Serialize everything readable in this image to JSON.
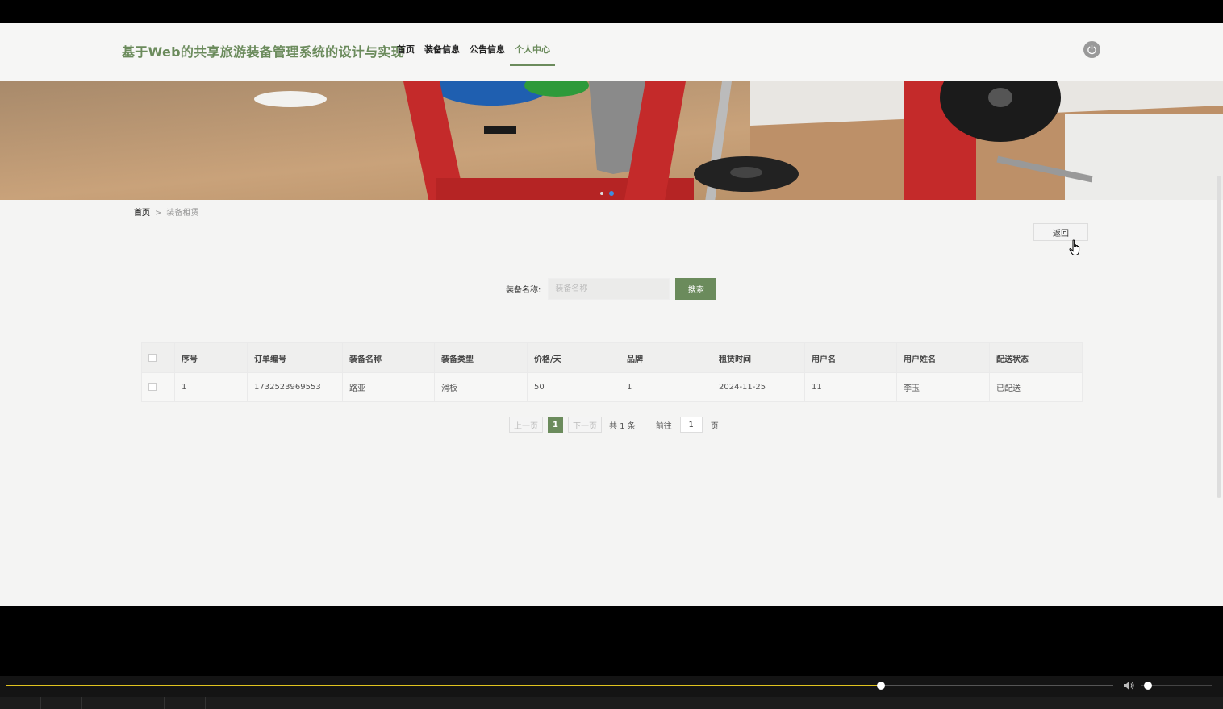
{
  "header": {
    "site_title": "基于Web的共享旅游装备管理系统的设计与实现",
    "nav": [
      "首页",
      "装备信息",
      "公告信息",
      "个人中心"
    ],
    "active_nav": "个人中心"
  },
  "breadcrumb": {
    "home": "首页",
    "separator": ">",
    "current": "装备租赁"
  },
  "actions": {
    "back_label": "返回"
  },
  "search": {
    "label": "装备名称:",
    "placeholder": "装备名称",
    "value": "",
    "button_label": "搜索"
  },
  "table": {
    "columns": [
      "序号",
      "订单编号",
      "装备名称",
      "装备类型",
      "价格/天",
      "品牌",
      "租赁时间",
      "用户名",
      "用户姓名",
      "配送状态"
    ],
    "rows": [
      [
        "1",
        "1732523969553",
        "路亚",
        "滑板",
        "50",
        "1",
        "2024-11-25",
        "11",
        "李玉",
        "已配送"
      ]
    ]
  },
  "pagination": {
    "prev_label": "上一页",
    "current_page": "1",
    "next_label": "下一页",
    "total_text": "共 1 条",
    "goto_label": "前往",
    "goto_value": "1",
    "page_suffix": "页"
  },
  "player": {
    "progress_fraction": 0.79,
    "volume_fraction": 0.1
  },
  "colors": {
    "accent": "#6b8b5c",
    "progress": "#e0c31f"
  }
}
